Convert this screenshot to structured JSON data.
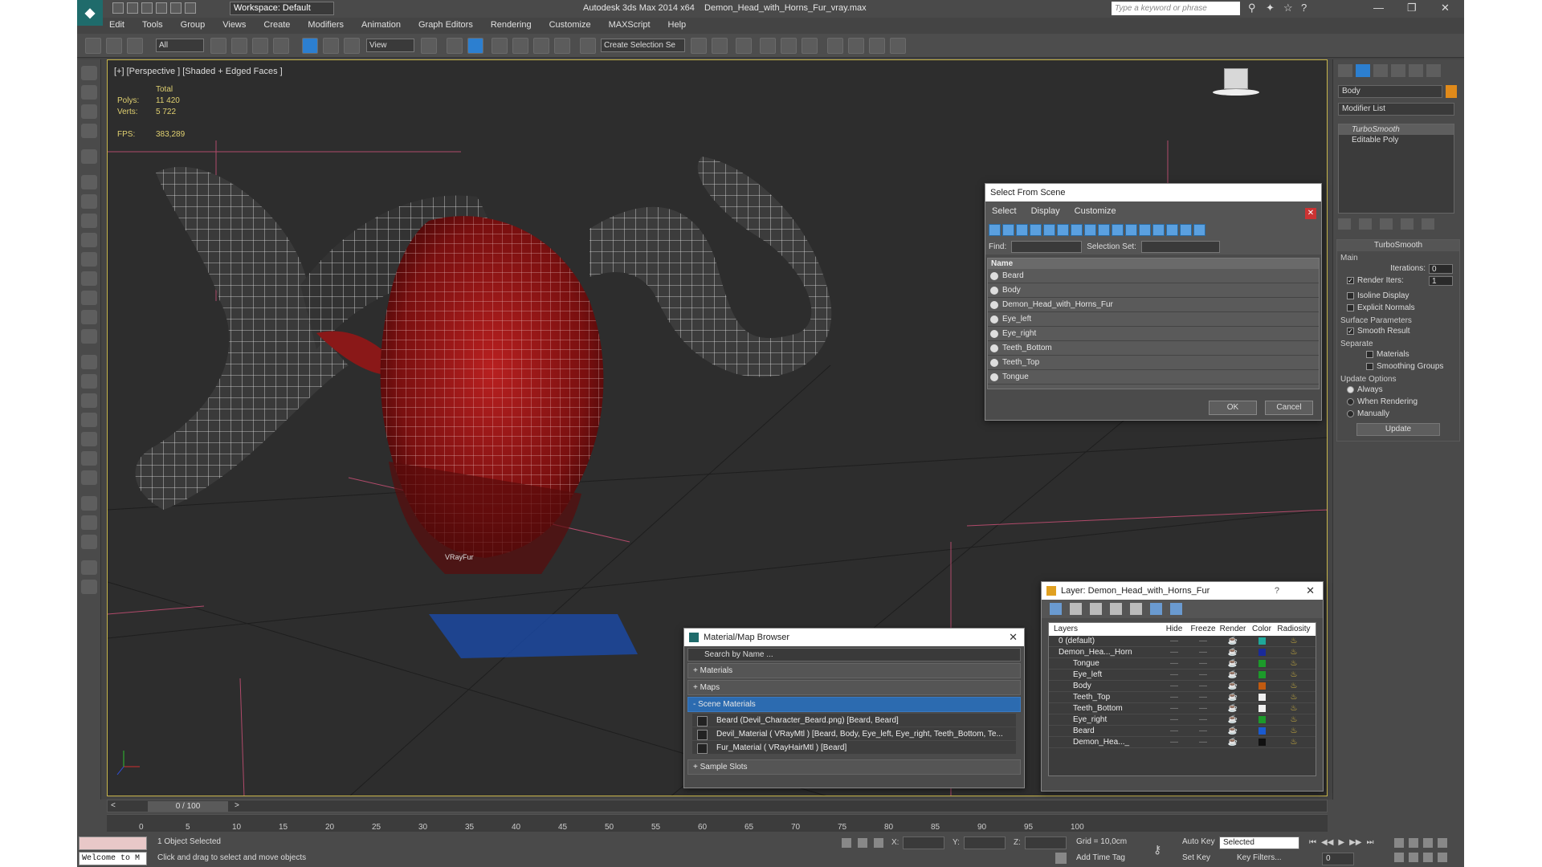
{
  "app": {
    "title": "Autodesk 3ds Max  2014 x64",
    "filename": "Demon_Head_with_Horns_Fur_vray.max",
    "workspace": "Workspace: Default",
    "search_placeholder": "Type a keyword or phrase"
  },
  "menu": [
    "Edit",
    "Tools",
    "Group",
    "Views",
    "Create",
    "Modifiers",
    "Animation",
    "Graph Editors",
    "Rendering",
    "Customize",
    "MAXScript",
    "Help"
  ],
  "toolbar": {
    "selection_filter": "All",
    "ref_coord": "View",
    "create_selection_set": "Create Selection Se"
  },
  "viewport": {
    "label": "[+] [Perspective ] [Shaded + Edged Faces ]",
    "stats": {
      "total_label": "Total",
      "polys_label": "Polys:",
      "polys": "11 420",
      "verts_label": "Verts:",
      "verts": "5 722",
      "fps_label": "FPS:",
      "fps": "383,289"
    },
    "object_label": "VRayFur"
  },
  "command_panel": {
    "object_name": "Body",
    "modifier_list": "Modifier List",
    "stack": [
      "TurboSmooth",
      "Editable Poly"
    ],
    "turbosmooth": {
      "title": "TurboSmooth",
      "main": "Main",
      "iterations_label": "Iterations:",
      "iterations": "0",
      "render_iters_label": "Render Iters:",
      "render_iters": "1",
      "isoline": "Isoline Display",
      "explicit_normals": "Explicit Normals",
      "surface_params": "Surface Parameters",
      "smooth_result": "Smooth Result",
      "separate": "Separate",
      "materials": "Materials",
      "smoothing_groups": "Smoothing Groups",
      "update_options": "Update Options",
      "always": "Always",
      "when_rendering": "When Rendering",
      "manually": "Manually",
      "update": "Update"
    }
  },
  "select_from_scene": {
    "title": "Select From Scene",
    "tabs": [
      "Select",
      "Display",
      "Customize"
    ],
    "find_label": "Find:",
    "selection_set_label": "Selection Set:",
    "column_name": "Name",
    "items": [
      "Beard",
      "Body",
      "Demon_Head_with_Horns_Fur",
      "Eye_left",
      "Eye_right",
      "Teeth_Bottom",
      "Teeth_Top",
      "Tongue"
    ],
    "ok": "OK",
    "cancel": "Cancel"
  },
  "material_browser": {
    "title": "Material/Map Browser",
    "search_placeholder": "Search by Name ...",
    "sections": [
      "+ Materials",
      "+ Maps",
      "- Scene Materials"
    ],
    "scene_materials": [
      "Beard (Devil_Character_Beard.png) [Beard, Beard]",
      "Devil_Material  ( VRayMtl ) [Beard, Body, Eye_left, Eye_right, Teeth_Bottom, Te...",
      "Fur_Material  ( VRayHairMtl ) [Beard]"
    ],
    "sample_slots": "+ Sample Slots"
  },
  "layer_dialog": {
    "title": "Layer: Demon_Head_with_Horns_Fur",
    "columns": [
      "Layers",
      "Hide",
      "Freeze",
      "Render",
      "Color",
      "Radiosity"
    ],
    "rows": [
      {
        "name": "0 (default)",
        "color": "#1fa89a"
      },
      {
        "name": "Demon_Hea..._Horn",
        "color": "#1a2a9a"
      },
      {
        "name": "Tongue",
        "color": "#1c9a2a"
      },
      {
        "name": "Eye_left",
        "color": "#1c9a2a"
      },
      {
        "name": "Body",
        "color": "#c05a10"
      },
      {
        "name": "Teeth_Top",
        "color": "#f0f0f0"
      },
      {
        "name": "Teeth_Bottom",
        "color": "#f0f0f0"
      },
      {
        "name": "Eye_right",
        "color": "#1c9a2a"
      },
      {
        "name": "Beard",
        "color": "#1a5ad0"
      },
      {
        "name": "Demon_Hea..._",
        "color": "#111111"
      }
    ]
  },
  "timeline": {
    "frame": "0 / 100",
    "ticks": [
      "0",
      "5",
      "10",
      "15",
      "20",
      "25",
      "30",
      "35",
      "40",
      "45",
      "50",
      "55",
      "60",
      "65",
      "70",
      "75",
      "80",
      "85",
      "90",
      "95",
      "100"
    ]
  },
  "status": {
    "maxscript": "Welcome to M",
    "selected": "1 Object Selected",
    "prompt": "Click and drag to select and move objects",
    "x_label": "X:",
    "y_label": "Y:",
    "z_label": "Z:",
    "grid": "Grid = 10,0cm",
    "add_time_tag": "Add Time Tag",
    "auto_key": "Auto Key",
    "set_key": "Set Key",
    "key_mode": "Selected",
    "key_filters": "Key Filters...",
    "frame_field": "0"
  }
}
